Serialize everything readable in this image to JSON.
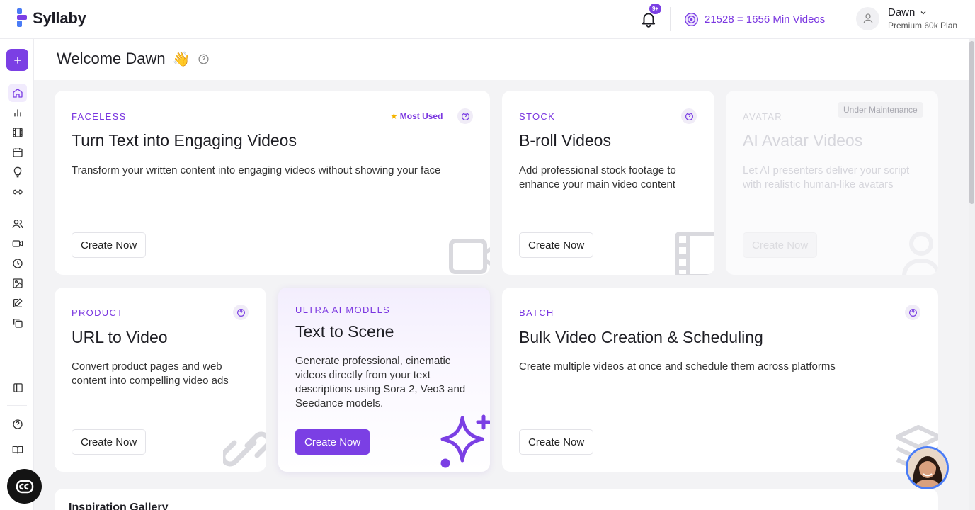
{
  "brand": {
    "name": "Syllaby"
  },
  "header": {
    "notification_badge": "9+",
    "credits_text": "21528 = 1656 Min Videos",
    "user_name": "Dawn",
    "user_plan": "Premium 60k Plan"
  },
  "welcome": {
    "text": "Welcome Dawn",
    "emoji": "👋"
  },
  "cards": {
    "faceless": {
      "tag": "FACELESS",
      "badge": "Most Used",
      "title": "Turn Text into Engaging Videos",
      "desc": "Transform your written content into engaging videos without showing your face",
      "cta": "Create Now"
    },
    "stock": {
      "tag": "STOCK",
      "title": "B-roll Videos",
      "desc": "Add professional stock footage to enhance your main video content",
      "cta": "Create Now"
    },
    "avatar": {
      "tag": "AVATAR",
      "status": "Under Maintenance",
      "title": "AI Avatar Videos",
      "desc": "Let AI presenters deliver your script with realistic human-like avatars",
      "cta": "Create Now"
    },
    "product": {
      "tag": "PRODUCT",
      "title": "URL to Video",
      "desc": "Convert product pages and web content into compelling video ads",
      "cta": "Create Now"
    },
    "scene": {
      "tag": "ULTRA AI MODELS",
      "title": "Text to Scene",
      "desc": "Generate professional, cinematic videos directly from your text descriptions using Sora 2, Veo3 and Seedance models.",
      "cta": "Create Now"
    },
    "batch": {
      "tag": "BATCH",
      "title": "Bulk Video Creation & Scheduling",
      "desc": "Create multiple videos at once and schedule them across platforms",
      "cta": "Create Now"
    }
  },
  "gallery": {
    "title": "Inspiration Gallery"
  },
  "colors": {
    "accent": "#7b3fe4",
    "assistant_ring": "#4a7cf6"
  }
}
